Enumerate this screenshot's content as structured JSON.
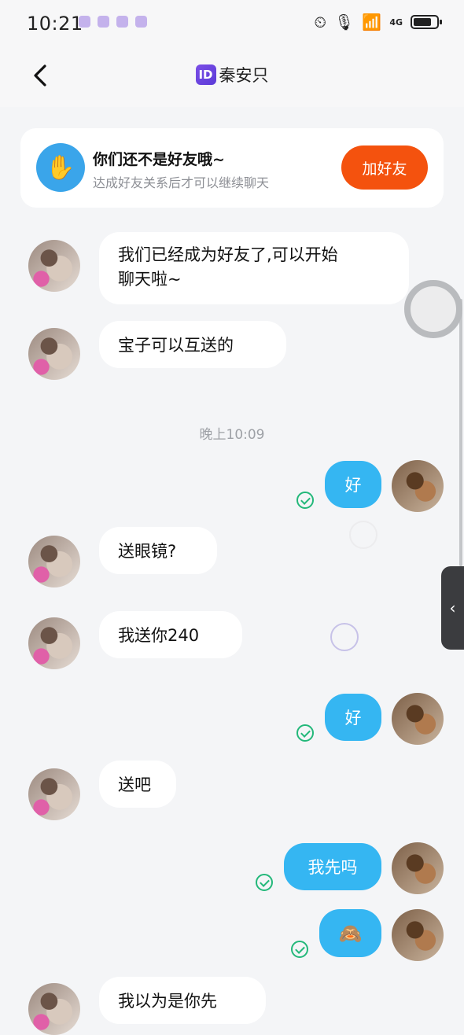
{
  "status_bar": {
    "time": "10:21",
    "network": "4G"
  },
  "header": {
    "badge": "ID",
    "title": "秦安只"
  },
  "friend_banner": {
    "title": "你们还不是好友哦~",
    "subtitle": "达成好友关系后才可以继续聊天",
    "button": "加好友"
  },
  "messages": [
    {
      "text": "我们已经成为好友了,可以开始",
      "text2": "聊天啦~"
    },
    {
      "text": "宝子可以互送的"
    },
    {
      "text": "好"
    },
    {
      "text": "送眼镜?"
    },
    {
      "text": "我送你240"
    },
    {
      "text": "好"
    },
    {
      "text": "送吧"
    },
    {
      "text": "我先吗"
    },
    {
      "text": "🙈"
    },
    {
      "text": "我以为是你先"
    }
  ],
  "timestamp": "晚上10:09",
  "icons": {
    "back": "chevron-left-icon",
    "wave": "hand-wave-icon",
    "read": "check-circle-icon",
    "side_handle": "chevron-left-icon"
  },
  "colors": {
    "accent": "#f4520e",
    "outgoing_bubble": "#35b6f2",
    "read_check": "#23b87a",
    "id_badge": "#6a45e0"
  }
}
